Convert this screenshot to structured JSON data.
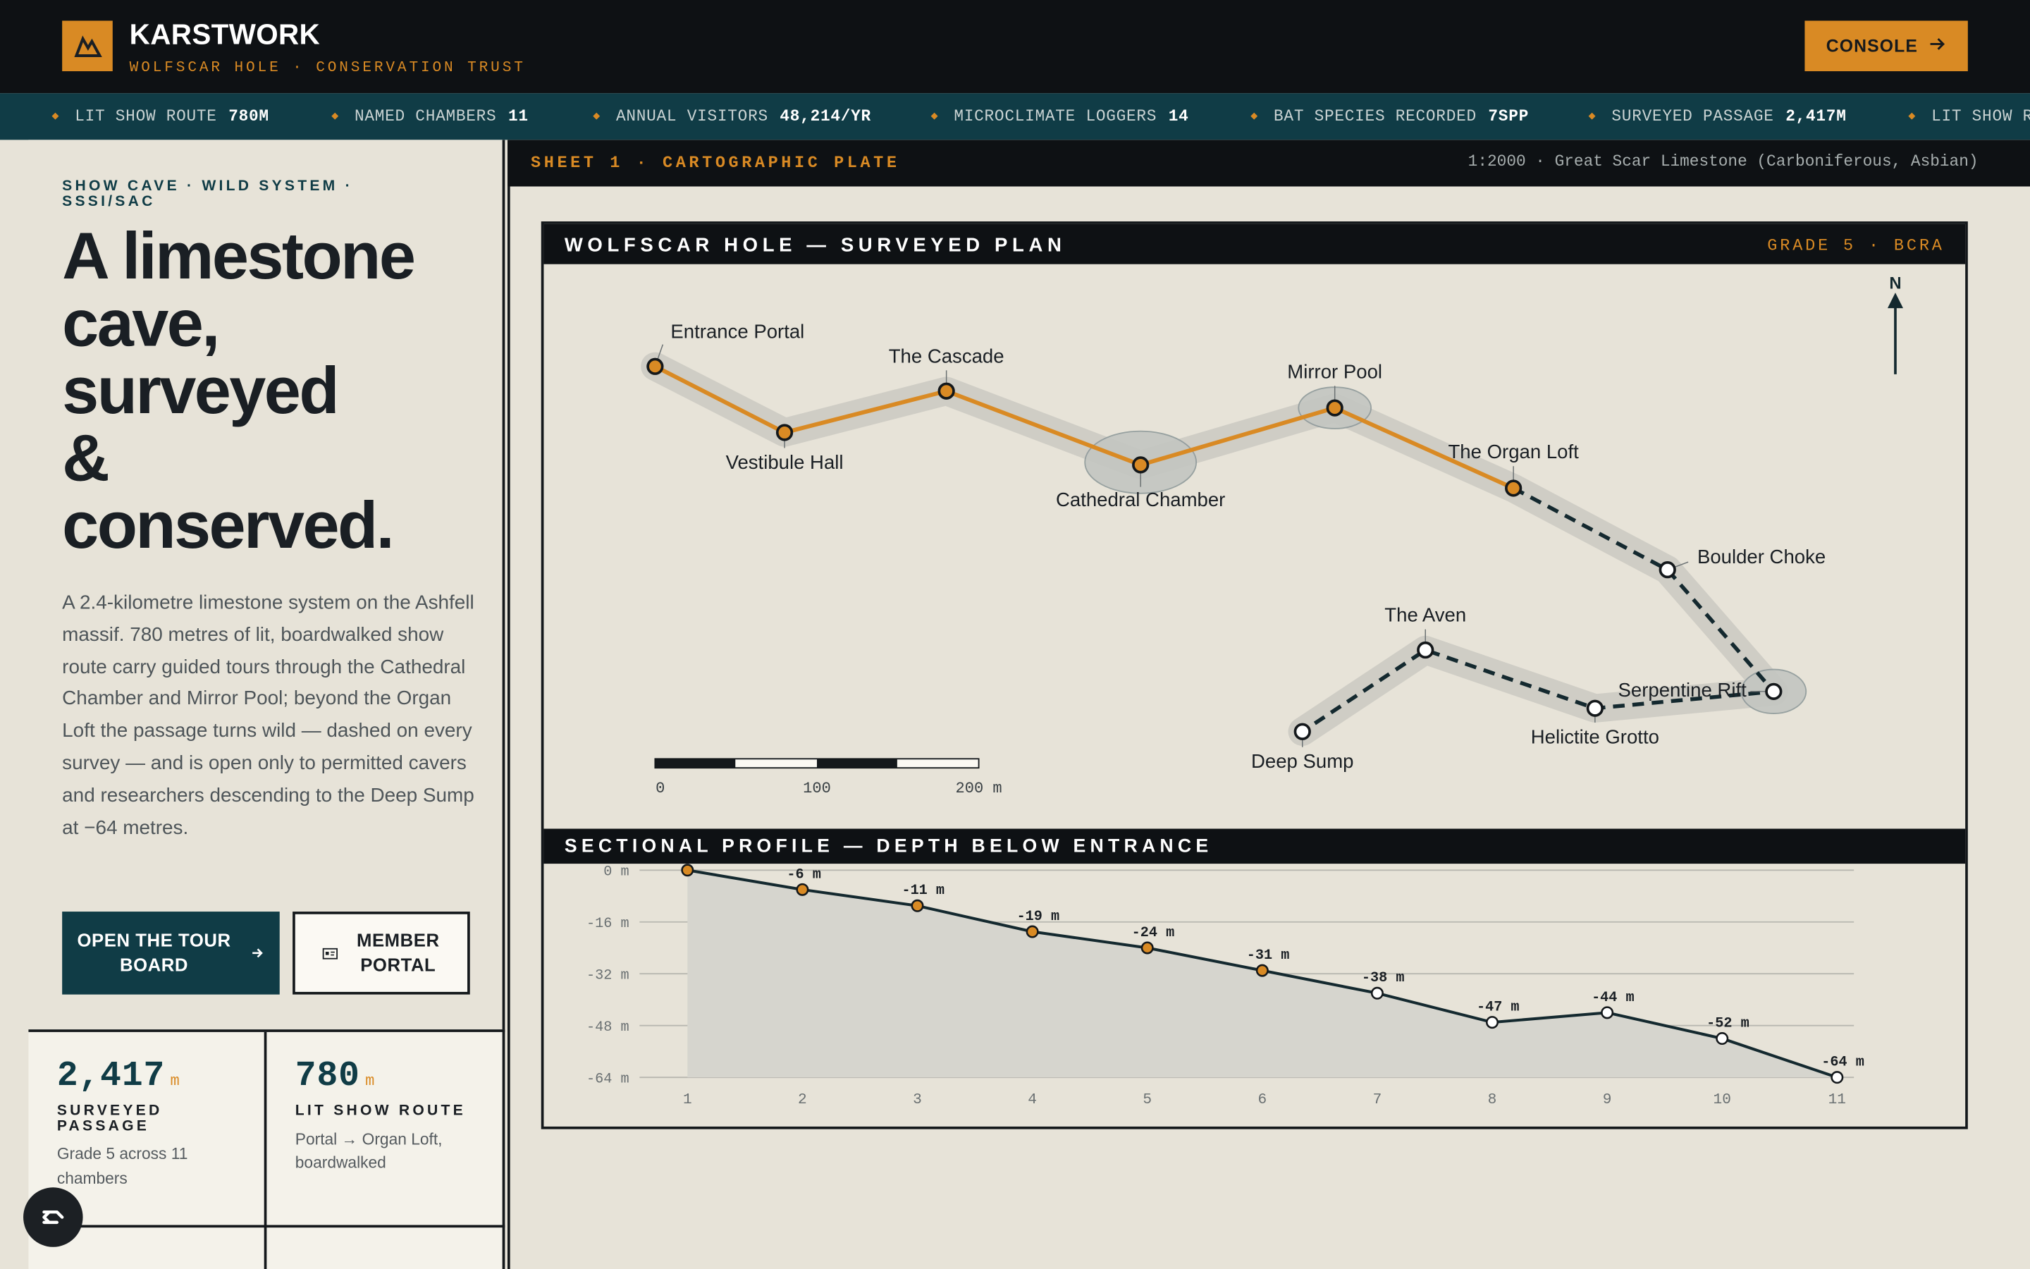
{
  "header": {
    "brand": "KARSTWORK",
    "subtitle": "WOLFSCAR HOLE · CONSERVATION TRUST",
    "console_label": "CONSOLE",
    "logo_icon": "mountain-icon",
    "accent_color": "#d98a24",
    "bg_color": "#0e1114"
  },
  "ticker": [
    {
      "label": "LIT SHOW ROUTE",
      "value": "780M"
    },
    {
      "label": "NAMED CHAMBERS",
      "value": "11"
    },
    {
      "label": "ANNUAL VISITORS",
      "value": "48,214/YR"
    },
    {
      "label": "MICROCLIMATE LOGGERS",
      "value": "14"
    },
    {
      "label": "BAT SPECIES RECORDED",
      "value": "7SPP"
    },
    {
      "label": "SURVEYED PASSAGE",
      "value": "2,417M"
    },
    {
      "label": "LIT SHOW R",
      "value": ""
    }
  ],
  "hero": {
    "eyebrow": "SHOW CAVE · WILD SYSTEM · SSSI/SAC",
    "line1": "A limestone",
    "line2": "cave,",
    "line3": "surveyed",
    "line4": "&",
    "line5": "conserved.",
    "lede": "A 2.4-kilometre limestone system on the Ashfell massif. 780 metres of lit, boardwalked show route carry guided tours through the Cathedral Chamber and Mirror Pool; beyond the Organ Loft the passage turns wild — dashed on every survey — and is open only to permitted cavers and researchers descending to the Deep Sump at −64 metres.",
    "primary_btn_line1": "OPEN THE TOUR",
    "primary_btn_line2": "BOARD",
    "secondary_btn_line1": "MEMBER",
    "secondary_btn_line2": "PORTAL"
  },
  "stats": [
    {
      "value": "2,417",
      "unit": "m",
      "label": "SURVEYED PASSAGE",
      "desc": "Grade 5 across 11 chambers"
    },
    {
      "value": "780",
      "unit": "m",
      "label": "LIT SHOW ROUTE",
      "desc": "Portal → Organ Loft, boardwalked"
    }
  ],
  "sheet": {
    "left": "SHEET 1 · CARTOGRAPHIC PLATE",
    "right": "1:2000 · Great Scar Limestone (Carboniferous, Asbian)"
  },
  "plan": {
    "title": "WOLFSCAR HOLE — SURVEYED PLAN",
    "grade": "GRADE 5 · BCRA",
    "north": "N",
    "scale_labels": [
      "0",
      "100",
      "200 m"
    ],
    "stations": [
      {
        "name": "Entrance Portal",
        "type": "show"
      },
      {
        "name": "Vestibule Hall",
        "type": "show"
      },
      {
        "name": "The Cascade",
        "type": "show"
      },
      {
        "name": "Cathedral Chamber",
        "type": "show"
      },
      {
        "name": "Mirror Pool",
        "type": "show"
      },
      {
        "name": "The Organ Loft",
        "type": "show"
      },
      {
        "name": "Boulder Choke",
        "type": "wild"
      },
      {
        "name": "Serpentine Rift",
        "type": "wild"
      },
      {
        "name": "Helictite Grotto",
        "type": "wild"
      },
      {
        "name": "The Aven",
        "type": "wild"
      },
      {
        "name": "Deep Sump",
        "type": "wild"
      }
    ]
  },
  "profile": {
    "title": "SECTIONAL PROFILE — DEPTH BELOW ENTRANCE"
  },
  "chart_data": {
    "type": "line",
    "title": "SECTIONAL PROFILE — DEPTH BELOW ENTRANCE",
    "x": [
      1,
      2,
      3,
      4,
      5,
      6,
      7,
      8,
      9,
      10,
      11
    ],
    "values": [
      0,
      -6,
      -11,
      -19,
      -24,
      -31,
      -38,
      -47,
      -44,
      -52,
      -64
    ],
    "point_labels": [
      "",
      "-6 m",
      "-11 m",
      "-19 m",
      "-24 m",
      "-31 m",
      "-38 m",
      "-47 m",
      "-44 m",
      "-52 m",
      "-64 m"
    ],
    "y_ticks": [
      "0 m",
      "-16 m",
      "-32 m",
      "-48 m",
      "-64 m"
    ],
    "x_tick_labels": [
      "1",
      "2",
      "3",
      "4",
      "5",
      "6",
      "7",
      "8",
      "9",
      "10",
      "11"
    ],
    "ylim": [
      -64,
      0
    ],
    "grid": true,
    "show_route_stations": 6,
    "colors": {
      "show": "#d98a24",
      "wild": "#ffffff",
      "line": "#14292f"
    }
  }
}
